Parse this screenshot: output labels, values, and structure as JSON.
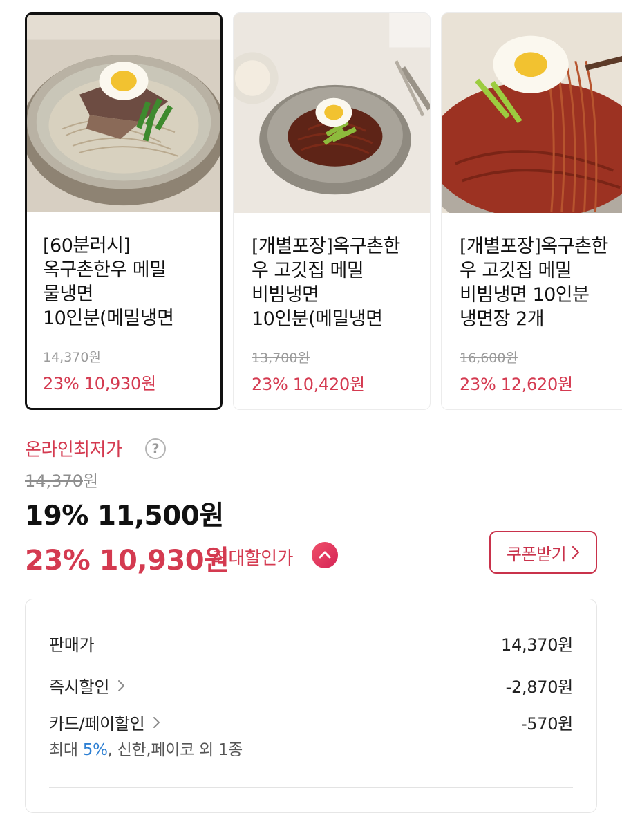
{
  "products": [
    {
      "name_lines": [
        "[60분러시]",
        "옥구촌한우 메밀",
        "물냉면",
        "10인분(메밀냉면"
      ],
      "original_price": "14,370원",
      "sale_price": "23% 10,930원",
      "selected": true
    },
    {
      "name_lines": [
        "[개별포장]옥구촌한",
        "우 고깃집 메밀",
        "비빔냉면",
        "10인분(메밀냉면"
      ],
      "original_price": "13,700원",
      "sale_price": "23% 10,420원",
      "selected": false
    },
    {
      "name_lines": [
        "[개별포장]옥구촌한",
        "우 고깃집 메밀",
        "비빔냉면 10인분",
        "냉면장 2개"
      ],
      "original_price": "16,600원",
      "sale_price": "23% 12,620원",
      "selected": false
    }
  ],
  "pricing": {
    "lowest_label": "온라인최저가",
    "help_glyph": "?",
    "original_number": "14,370",
    "original_unit": "원",
    "current_price": "19% 11,500원",
    "max_discount_price": "23% 10,930원",
    "max_discount_label": "최대할인가",
    "coupon_button": "쿠폰받기"
  },
  "breakdown": {
    "rows": [
      {
        "label": "판매가",
        "value": "14,370원",
        "has_chevron": false
      },
      {
        "label": "즉시할인",
        "value": "-2,870원",
        "has_chevron": true
      },
      {
        "label": "카드/페이할인",
        "value": "-570원",
        "has_chevron": true
      }
    ],
    "subnote_prefix": "최대 ",
    "subnote_highlight": "5%",
    "subnote_suffix": ", 신한,페이코 외 1종"
  },
  "colors": {
    "accent_red": "#d43a50",
    "link_blue": "#2d7fd3"
  },
  "icons": {
    "help": "question-circle-icon",
    "caret": "chevron-up-icon",
    "chevron": "chevron-right-icon"
  }
}
